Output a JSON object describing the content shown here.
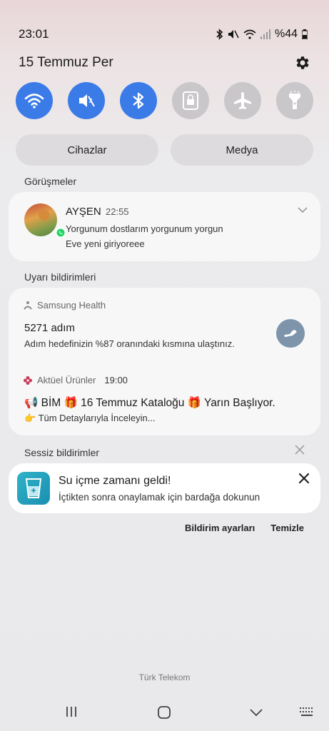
{
  "status_bar": {
    "time": "23:01",
    "battery": "%44"
  },
  "header": {
    "date": "15 Temmuz Per"
  },
  "quick_settings": [
    {
      "name": "wifi",
      "on": true
    },
    {
      "name": "mute",
      "on": true
    },
    {
      "name": "bluetooth",
      "on": true
    },
    {
      "name": "rotation-lock",
      "on": false
    },
    {
      "name": "airplane",
      "on": false
    },
    {
      "name": "flashlight",
      "on": false
    }
  ],
  "pills": {
    "devices": "Cihazlar",
    "media": "Medya"
  },
  "sections": {
    "conversations": "Görüşmeler",
    "alerts": "Uyarı bildirimleri",
    "silent": "Sessiz bildirimler"
  },
  "conversation": {
    "name": "AYŞEN",
    "time": "22:55",
    "line1": "Yorgunum dostlarım yorgunum yorgun",
    "line2": "Eve yeni giriyoreee"
  },
  "health": {
    "app": "Samsung Health",
    "title": "5271 adım",
    "text": "Adım hedefinizin %87 oranındaki kısmına ulaştınız."
  },
  "bim": {
    "app": "Aktüel Ürünler",
    "time": "19:00",
    "title": "📢 BİM 🎁 16 Temmuz Kataloğu 🎁 Yarın Başlıyor.",
    "text": "👉 Tüm Detaylarıyla İnceleyin..."
  },
  "water": {
    "title": "Su içme zamanı geldi!",
    "text": "İçtikten sonra onaylamak için bardağa dokunun"
  },
  "actions": {
    "settings": "Bildirim ayarları",
    "clear": "Temizle"
  },
  "carrier": "Türk Telekom",
  "colors": {
    "accent": "#3b7be8",
    "off": "#c9c7c9",
    "card": "#f7f7f8"
  }
}
